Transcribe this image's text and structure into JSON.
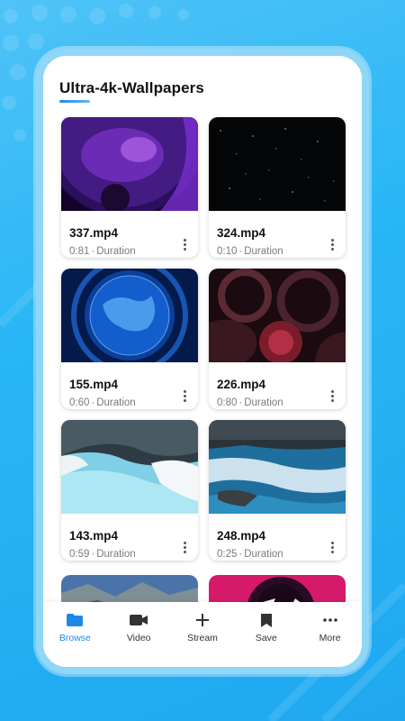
{
  "app": {
    "title": "Ultra-4k-Wallpapers"
  },
  "videos": [
    {
      "name": "337.mp4",
      "duration": "0:81",
      "duration_label": "Duration",
      "thumb": "purple-planet"
    },
    {
      "name": "324.mp4",
      "duration": "0:10",
      "duration_label": "Duration",
      "thumb": "dark-particles"
    },
    {
      "name": "155.mp4",
      "duration": "0:60",
      "duration_label": "Duration",
      "thumb": "blue-globe"
    },
    {
      "name": "226.mp4",
      "duration": "0:80",
      "duration_label": "Duration",
      "thumb": "red-stained-glass"
    },
    {
      "name": "143.mp4",
      "duration": "0:59",
      "duration_label": "Duration",
      "thumb": "snowy-river"
    },
    {
      "name": "248.mp4",
      "duration": "0:25",
      "duration_label": "Duration",
      "thumb": "ocean-waves"
    }
  ],
  "bottom_nav": {
    "items": [
      {
        "label": "Browse",
        "icon": "folder-icon",
        "active": true
      },
      {
        "label": "Video",
        "icon": "video-camera-icon",
        "active": false
      },
      {
        "label": "Stream",
        "icon": "plus-icon",
        "active": false
      },
      {
        "label": "Save",
        "icon": "bookmark-icon",
        "active": false
      },
      {
        "label": "More",
        "icon": "more-horizontal-icon",
        "active": false
      }
    ]
  },
  "colors": {
    "accent": "#1e88e5",
    "background": "#29b6f6",
    "text_muted": "#7a7a7a"
  }
}
